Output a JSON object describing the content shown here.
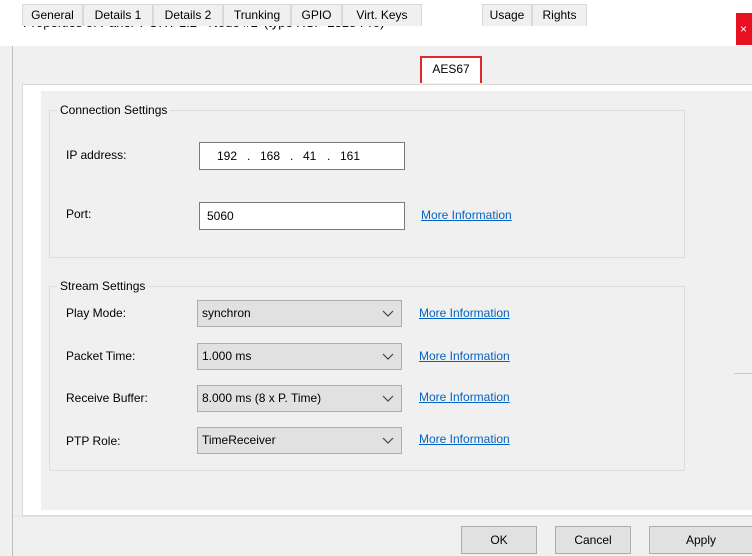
{
  "window": {
    "title": "Properties of Panel 'PORT 1.2 - Node #1' (type RSP-2318 Pro)",
    "close_glyph": "×"
  },
  "tabs": [
    {
      "label": "General"
    },
    {
      "label": "Details 1"
    },
    {
      "label": "Details 2"
    },
    {
      "label": "Trunking"
    },
    {
      "label": "GPIO"
    },
    {
      "label": "Virt. Keys"
    },
    {
      "label": "AES67"
    },
    {
      "label": "Usage"
    },
    {
      "label": "Rights"
    }
  ],
  "active_tab": "AES67",
  "connection": {
    "group_label": "Connection Settings",
    "ip_label": "IP address:",
    "ip": [
      "192",
      "168",
      "41",
      "161"
    ],
    "ip_dot": ".",
    "port_label": "Port:",
    "port_value": "5060",
    "port_link": "More Information"
  },
  "stream": {
    "group_label": "Stream Settings",
    "rows": [
      {
        "label": "Play Mode:",
        "value": "synchron",
        "link": "More Information"
      },
      {
        "label": "Packet Time:",
        "value": "1.000 ms",
        "link": "More Information"
      },
      {
        "label": "Receive Buffer:",
        "value": "8.000 ms (8 x P. Time)",
        "link": "More Information"
      },
      {
        "label": "PTP Role:",
        "value": "TimeReceiver",
        "link": "More Information"
      }
    ]
  },
  "buttons": {
    "ok": "OK",
    "cancel": "Cancel",
    "apply": "Apply"
  },
  "colors": {
    "active_tab_border": "#e0282a",
    "link": "#0563c1",
    "close_button": "#e81123"
  }
}
